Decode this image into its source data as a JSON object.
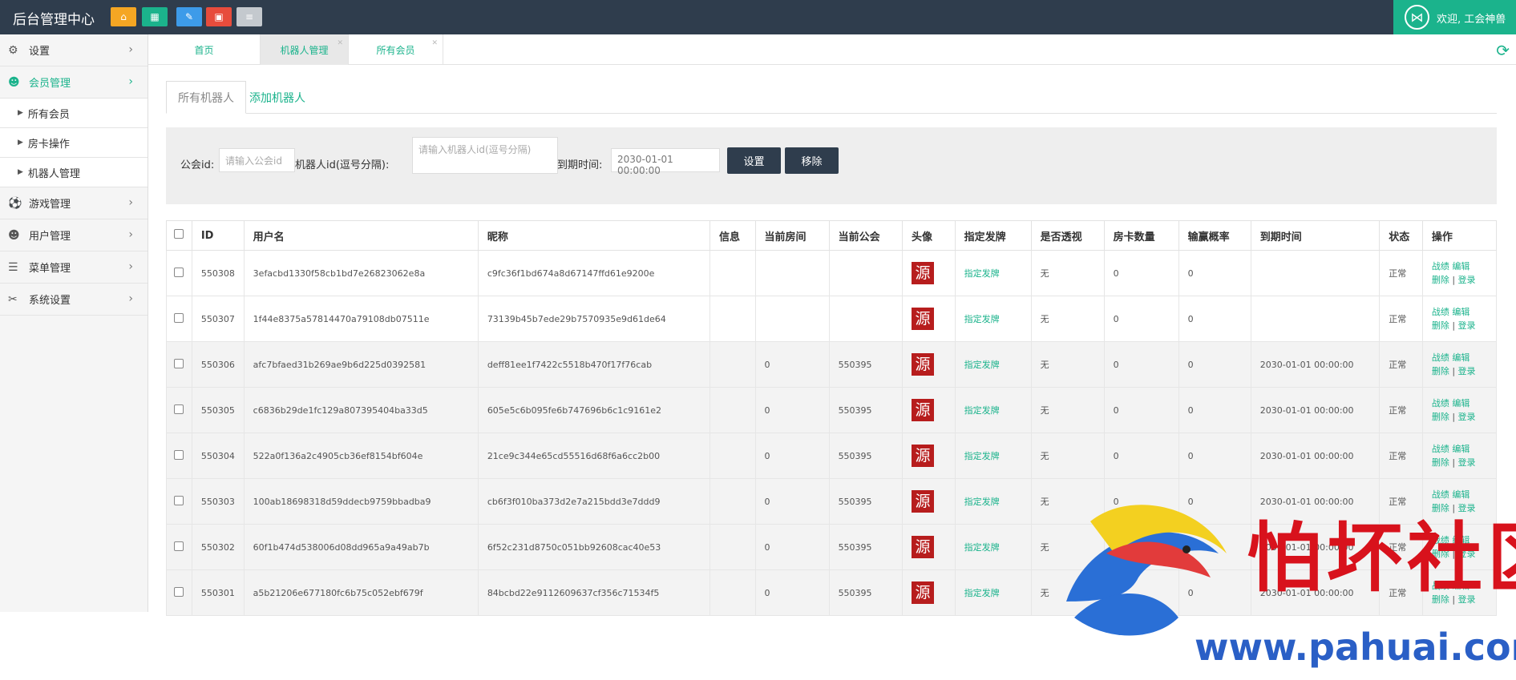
{
  "topbar": {
    "brand": "后台管理中心",
    "buttons": [
      {
        "icon": "home-icon",
        "glyph": "⌂",
        "color": "#f5a623"
      },
      {
        "icon": "grid-icon",
        "glyph": "▦",
        "color": "#1bb38c"
      },
      {
        "icon": "pencil-icon",
        "glyph": "✎",
        "color": "#3d9be9"
      },
      {
        "icon": "trash-icon",
        "glyph": "🗑",
        "color": "#e74c3c"
      },
      {
        "icon": "list-icon",
        "glyph": "≡",
        "color": "#c4c9ce"
      }
    ],
    "welcome": "欢迎, 工会神兽"
  },
  "sidebar": {
    "items": [
      {
        "label": "设置",
        "icon": "gears-icon",
        "glyph": "⚙"
      },
      {
        "label": "会员管理",
        "icon": "users-icon",
        "glyph": "👥"
      },
      {
        "label": "游戏管理",
        "icon": "soccer-ball-icon",
        "glyph": "⚽"
      },
      {
        "label": "用户管理",
        "icon": "users-icon",
        "glyph": "👥"
      },
      {
        "label": "菜单管理",
        "icon": "list-icon",
        "glyph": "☰"
      },
      {
        "label": "系统设置",
        "icon": "wrench-icon",
        "glyph": "🔧"
      }
    ],
    "subitems": [
      "所有会员",
      "房卡操作",
      "机器人管理"
    ]
  },
  "page_tabs": [
    {
      "label": "首页",
      "closable": false
    },
    {
      "label": "机器人管理",
      "closable": true
    },
    {
      "label": "所有会员",
      "closable": true
    }
  ],
  "content_tabs": [
    "所有机器人",
    "添加机器人"
  ],
  "filter": {
    "guild_label": "公会id:",
    "guild_placeholder": "请输入公会id",
    "robot_label": "机器人id(逗号分隔):",
    "robot_placeholder": "请输入机器人id(逗号分隔)",
    "expire_label": "到期时间:",
    "expire_value": "2030-01-01 00:00:00",
    "set_button": "设置",
    "remove_button": "移除"
  },
  "table": {
    "headers": [
      "ID",
      "用户名",
      "昵称",
      "信息",
      "当前房间",
      "当前公会",
      "头像",
      "指定发牌",
      "是否透视",
      "房卡数量",
      "输赢概率",
      "到期时间",
      "状态",
      "操作"
    ],
    "avatar_text": "源",
    "deal_label": "指定发牌",
    "action_record": "战绩",
    "action_edit": "编辑",
    "action_delete": "删除",
    "action_login": "登录",
    "sep": "|",
    "rows": [
      {
        "id": "550308",
        "username": "3efacbd1330f58cb1bd7e26823062e8a",
        "nickname": "c9fc36f1bd674a8d67147ffd61e9200e",
        "info": "",
        "room": "",
        "guild": "",
        "see": "无",
        "cards": "0",
        "rate": "0",
        "expire": "",
        "status": "正常"
      },
      {
        "id": "550307",
        "username": "1f44e8375a57814470a79108db07511e",
        "nickname": "73139b45b7ede29b7570935e9d61de64",
        "info": "",
        "room": "",
        "guild": "",
        "see": "无",
        "cards": "0",
        "rate": "0",
        "expire": "",
        "status": "正常"
      },
      {
        "id": "550306",
        "username": "afc7bfaed31b269ae9b6d225d0392581",
        "nickname": "deff81ee1f7422c5518b470f17f76cab",
        "info": "",
        "room": "0",
        "guild": "550395",
        "see": "无",
        "cards": "0",
        "rate": "0",
        "expire": "2030-01-01 00:00:00",
        "status": "正常"
      },
      {
        "id": "550305",
        "username": "c6836b29de1fc129a807395404ba33d5",
        "nickname": "605e5c6b095fe6b747696b6c1c9161e2",
        "info": "",
        "room": "0",
        "guild": "550395",
        "see": "无",
        "cards": "0",
        "rate": "0",
        "expire": "2030-01-01 00:00:00",
        "status": "正常"
      },
      {
        "id": "550304",
        "username": "522a0f136a2c4905cb36ef8154bf604e",
        "nickname": "21ce9c344e65cd55516d68f6a6cc2b00",
        "info": "",
        "room": "0",
        "guild": "550395",
        "see": "无",
        "cards": "0",
        "rate": "0",
        "expire": "2030-01-01 00:00:00",
        "status": "正常"
      },
      {
        "id": "550303",
        "username": "100ab18698318d59ddecb9759bbadba9",
        "nickname": "cb6f3f010ba373d2e7a215bdd3e7ddd9",
        "info": "",
        "room": "0",
        "guild": "550395",
        "see": "无",
        "cards": "0",
        "rate": "0",
        "expire": "2030-01-01 00:00:00",
        "status": "正常"
      },
      {
        "id": "550302",
        "username": "60f1b474d538006d08dd965a9a49ab7b",
        "nickname": "6f52c231d8750c051bb92608cac40e53",
        "info": "",
        "room": "0",
        "guild": "550395",
        "see": "无",
        "cards": "0",
        "rate": "0",
        "expire": "2030-01-01 00:00:00",
        "status": "正常"
      },
      {
        "id": "550301",
        "username": "a5b21206e677180fc6b75c052ebf679f",
        "nickname": "84bcbd22e9112609637cf356c71534f5",
        "info": "",
        "room": "0",
        "guild": "550395",
        "see": "无",
        "cards": "0",
        "rate": "0",
        "expire": "2030-01-01 00:00:00",
        "status": "正常"
      }
    ]
  },
  "watermark": {
    "title": "怕坏社区",
    "url": "www.pahuai.com"
  },
  "colors": {
    "accent": "#1bb38c",
    "topbar": "#2f3d4d",
    "button_dark": "#2f3d4d",
    "avatar": "#b71d1d"
  }
}
